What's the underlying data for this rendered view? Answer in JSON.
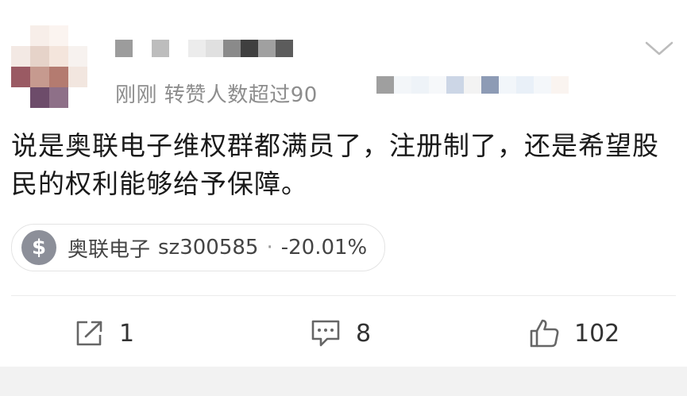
{
  "post": {
    "meta_text": "刚刚 转赞人数超过90",
    "content": "说是奥联电子维权群都满员了，注册制了，还是希望股民的权利能够给予保障。"
  },
  "stock": {
    "icon_symbol": "$",
    "name": "奥联电子",
    "code": "sz300585",
    "separator": "·",
    "change": "-20.01%"
  },
  "actions": {
    "share_count": "1",
    "comment_count": "8",
    "like_count": "102"
  },
  "colors": {
    "meta_gray": "#8d8d8d",
    "icon_gray": "#8c8f99",
    "bottom_bar": "#f2f2f2"
  }
}
